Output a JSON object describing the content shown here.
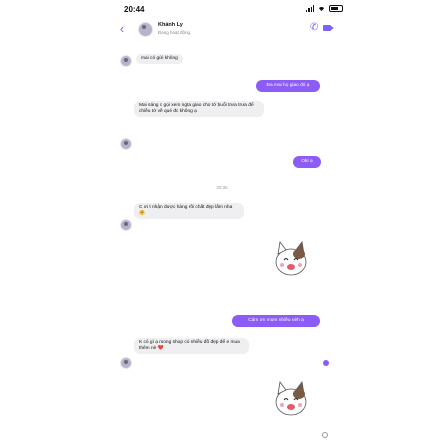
{
  "status_bar": {
    "time": "20:44"
  },
  "header": {
    "contact_name": "Khánh Ly",
    "contact_status": "Đang hoạt động",
    "partial_text": "... ... ... ... ... ... ... ... ..."
  },
  "messages": [
    {
      "id": "m1",
      "direction": "in",
      "text": "mai có gửi không"
    },
    {
      "id": "m2",
      "direction": "out",
      "text": "Đa mai họ giao đó ạ"
    },
    {
      "id": "m3",
      "direction": "in",
      "text": "Mai sáng c gọi xem ngta giao cho tớ buổi trưa trưa để chiều tớ về qué đc không ạ"
    },
    {
      "id": "m4",
      "direction": "out",
      "text": "Okí ạ"
    },
    {
      "id": "m5",
      "direction": "in",
      "text": "C ơi t nhận được hàng rồi chất đẹp lắm nha"
    },
    {
      "id": "m6",
      "direction": "out",
      "text": "Cảm ơn mom nhiều nèh ạ"
    },
    {
      "id": "m7",
      "direction": "in",
      "text": "K có gì ạ mong shop có nhiều đồ đẹp để e mua thêm nè"
    }
  ],
  "timestamp": "20:36",
  "emoji": {
    "m5": "🤗",
    "m7": "❤️"
  },
  "colors": {
    "accent": "#8b5cf6",
    "incoming_bubble": "#efeff2"
  },
  "icons": [
    "back-icon",
    "call-icon",
    "video-icon"
  ]
}
